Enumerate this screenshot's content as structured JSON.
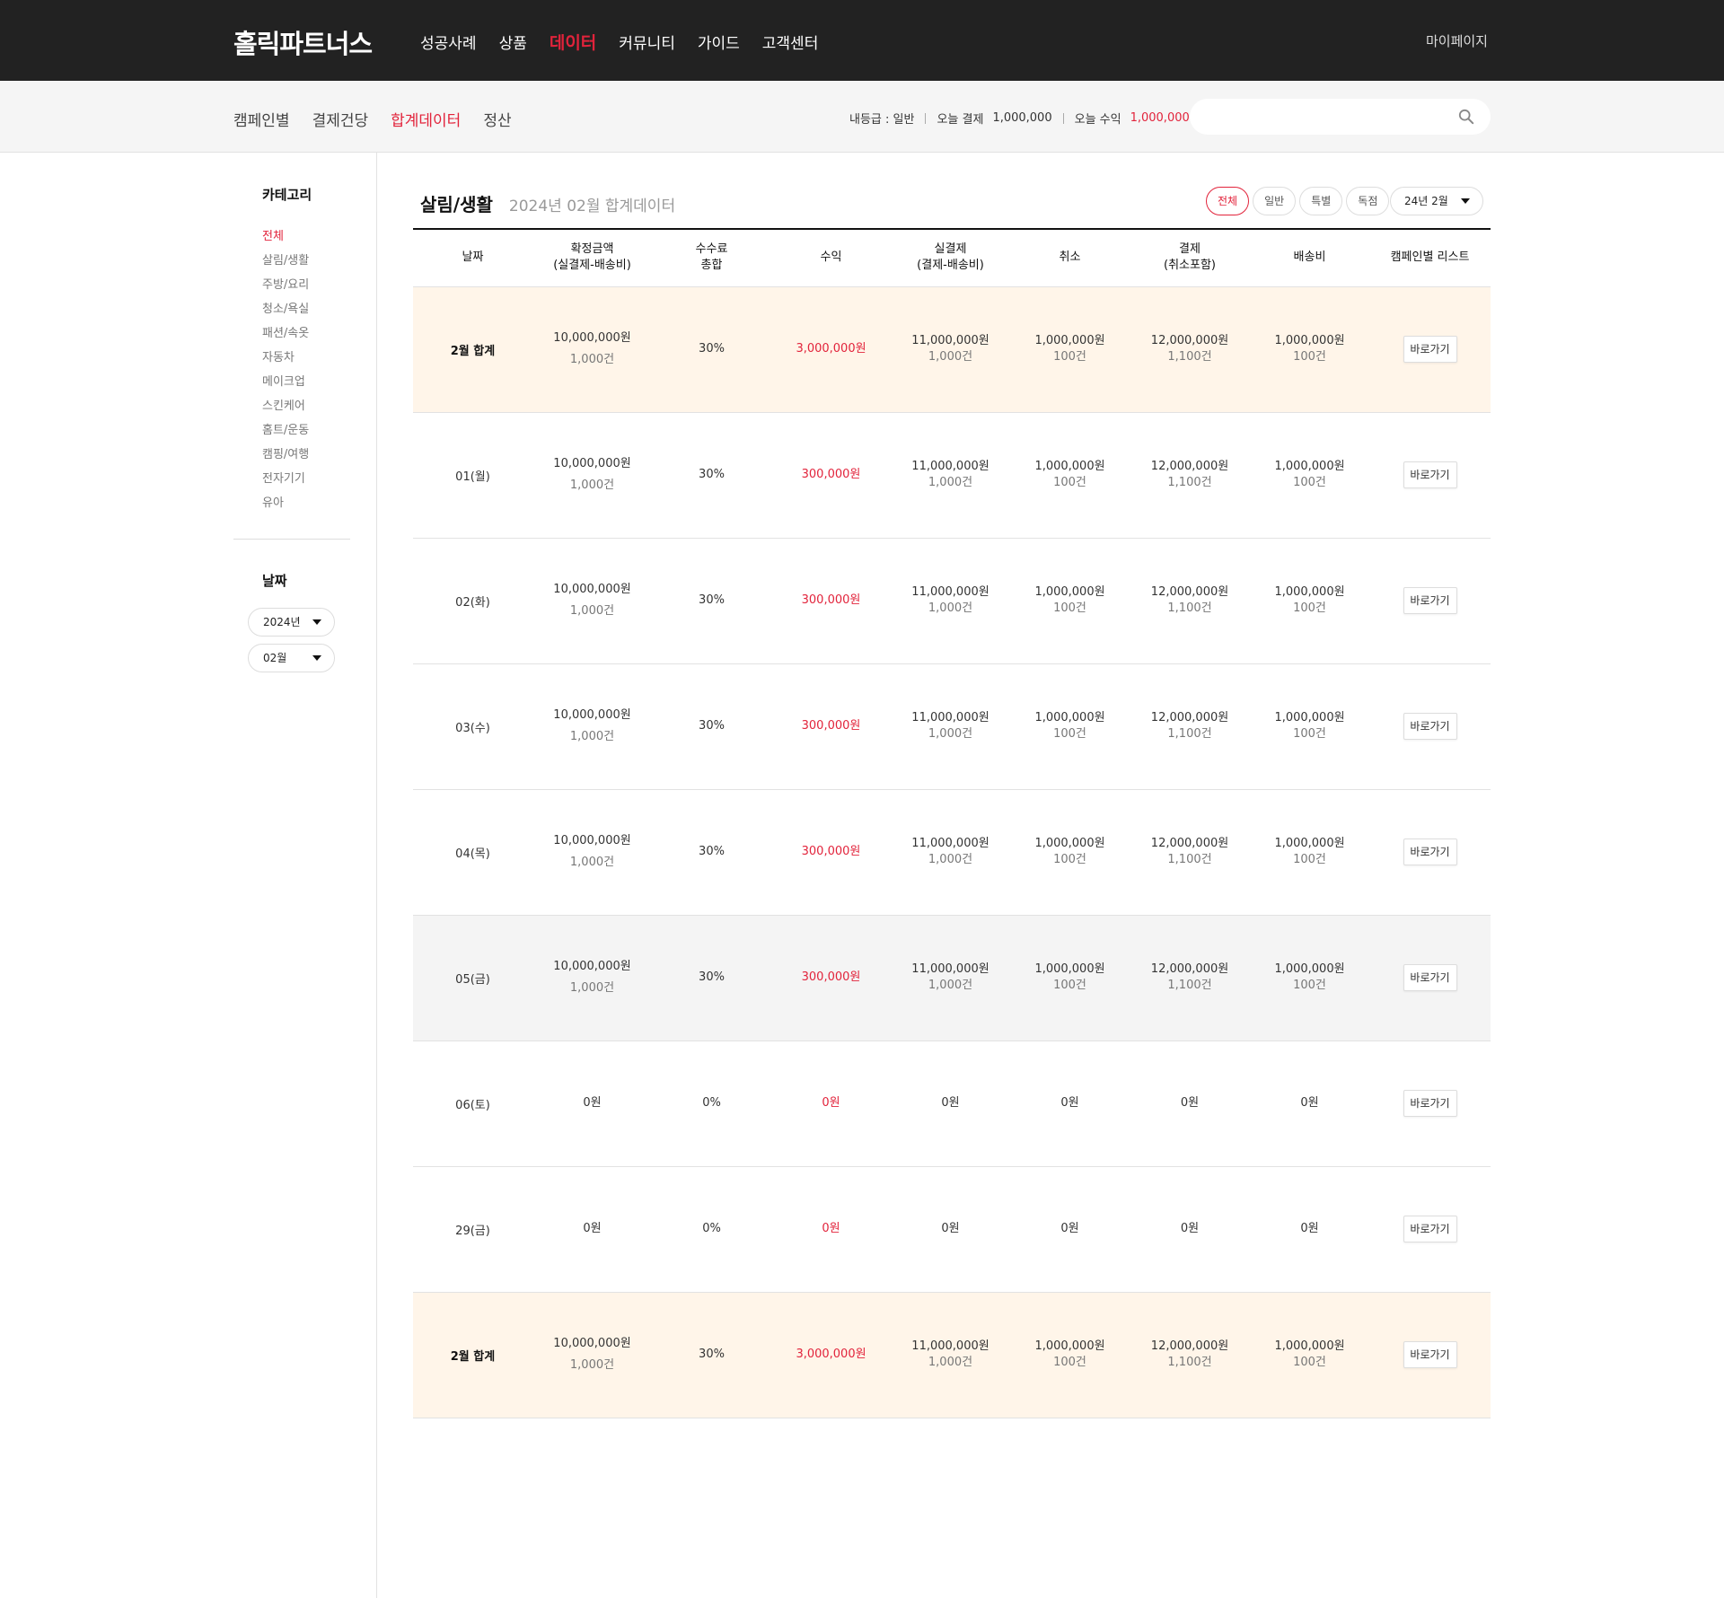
{
  "header": {
    "logo": "홀릭파트너스",
    "nav": [
      "성공사례",
      "상품",
      "데이터",
      "커뮤니티",
      "가이드",
      "고객센터"
    ],
    "nav_active_index": 2,
    "mypage": "마이페이지"
  },
  "subnav": {
    "items": [
      "캠페인별",
      "결제건당",
      "합계데이터",
      "정산"
    ],
    "active_index": 2,
    "grade_label": "내등급 : 일반",
    "today_pay_label": "오늘 결제",
    "today_pay_value": "1,000,000",
    "today_rev_label": "오늘 수익",
    "today_rev_value": "1,000,000",
    "search_placeholder": ""
  },
  "sidebar": {
    "category_title": "카테고리",
    "categories": [
      "전체",
      "살림/생활",
      "주방/요리",
      "청소/욕실",
      "패션/속옷",
      "자동차",
      "메이크업",
      "스킨케어",
      "홈트/운동",
      "캠핑/여행",
      "전자기기",
      "유아"
    ],
    "category_active_index": 0,
    "date_title": "날짜",
    "year_select": "2024년",
    "month_select": "02월"
  },
  "main": {
    "category": "살림/생활",
    "subtitle": "2024년 02월 합계데이터",
    "filters": [
      "전체",
      "일반",
      "특별",
      "독점"
    ],
    "filter_active_index": 0,
    "month_select": "24년 2월",
    "columns": [
      "날짜",
      "확정금액\n(실결제-배송비)",
      "수수료\n총합",
      "수익",
      "실결제\n(결제-배송비)",
      "취소",
      "결제\n(취소포함)",
      "배송비",
      "캠페인별 리스트"
    ],
    "button_label": "바로가기",
    "rows": [
      {
        "type": "sum",
        "date": "2월 합계",
        "confirmed": "10,000,000원",
        "confirmed_count": "1,000건",
        "fee": "30%",
        "revenue": "3,000,000원",
        "actual": "11,000,000원",
        "actual_count": "1,000건",
        "cancel": "1,000,000원",
        "cancel_count": "100건",
        "payment": "12,000,000원",
        "payment_count": "1,100건",
        "shipping": "1,000,000원",
        "shipping_count": "100건"
      },
      {
        "type": "normal",
        "date": "01(월)",
        "confirmed": "10,000,000원",
        "confirmed_count": "1,000건",
        "fee": "30%",
        "revenue": "300,000원",
        "actual": "11,000,000원",
        "actual_count": "1,000건",
        "cancel": "1,000,000원",
        "cancel_count": "100건",
        "payment": "12,000,000원",
        "payment_count": "1,100건",
        "shipping": "1,000,000원",
        "shipping_count": "100건"
      },
      {
        "type": "normal",
        "date": "02(화)",
        "confirmed": "10,000,000원",
        "confirmed_count": "1,000건",
        "fee": "30%",
        "revenue": "300,000원",
        "actual": "11,000,000원",
        "actual_count": "1,000건",
        "cancel": "1,000,000원",
        "cancel_count": "100건",
        "payment": "12,000,000원",
        "payment_count": "1,100건",
        "shipping": "1,000,000원",
        "shipping_count": "100건"
      },
      {
        "type": "normal",
        "date": "03(수)",
        "confirmed": "10,000,000원",
        "confirmed_count": "1,000건",
        "fee": "30%",
        "revenue": "300,000원",
        "actual": "11,000,000원",
        "actual_count": "1,000건",
        "cancel": "1,000,000원",
        "cancel_count": "100건",
        "payment": "12,000,000원",
        "payment_count": "1,100건",
        "shipping": "1,000,000원",
        "shipping_count": "100건"
      },
      {
        "type": "normal",
        "date": "04(목)",
        "confirmed": "10,000,000원",
        "confirmed_count": "1,000건",
        "fee": "30%",
        "revenue": "300,000원",
        "actual": "11,000,000원",
        "actual_count": "1,000건",
        "cancel": "1,000,000원",
        "cancel_count": "100건",
        "payment": "12,000,000원",
        "payment_count": "1,100건",
        "shipping": "1,000,000원",
        "shipping_count": "100건"
      },
      {
        "type": "hl",
        "date": "05(금)",
        "confirmed": "10,000,000원",
        "confirmed_count": "1,000건",
        "fee": "30%",
        "revenue": "300,000원",
        "actual": "11,000,000원",
        "actual_count": "1,000건",
        "cancel": "1,000,000원",
        "cancel_count": "100건",
        "payment": "12,000,000원",
        "payment_count": "1,100건",
        "shipping": "1,000,000원",
        "shipping_count": "100건"
      },
      {
        "type": "normal",
        "date": "06(토)",
        "confirmed": "0원",
        "confirmed_count": "",
        "fee": "0%",
        "revenue": "0원",
        "actual": "0원",
        "actual_count": "",
        "cancel": "0원",
        "cancel_count": "",
        "payment": "0원",
        "payment_count": "",
        "shipping": "0원",
        "shipping_count": ""
      },
      {
        "type": "normal",
        "date": "29(금)",
        "confirmed": "0원",
        "confirmed_count": "",
        "fee": "0%",
        "revenue": "0원",
        "actual": "0원",
        "actual_count": "",
        "cancel": "0원",
        "cancel_count": "",
        "payment": "0원",
        "payment_count": "",
        "shipping": "0원",
        "shipping_count": ""
      },
      {
        "type": "sum",
        "date": "2월 합계",
        "confirmed": "10,000,000원",
        "confirmed_count": "1,000건",
        "fee": "30%",
        "revenue": "3,000,000원",
        "actual": "11,000,000원",
        "actual_count": "1,000건",
        "cancel": "1,000,000원",
        "cancel_count": "100건",
        "payment": "12,000,000원",
        "payment_count": "1,100건",
        "shipping": "1,000,000원",
        "shipping_count": "100건"
      }
    ]
  },
  "colors": {
    "accent": "#e2233b",
    "topbar": "#222222",
    "sum_row": "#fff5e9",
    "highlight_row": "#f4f4f4"
  }
}
